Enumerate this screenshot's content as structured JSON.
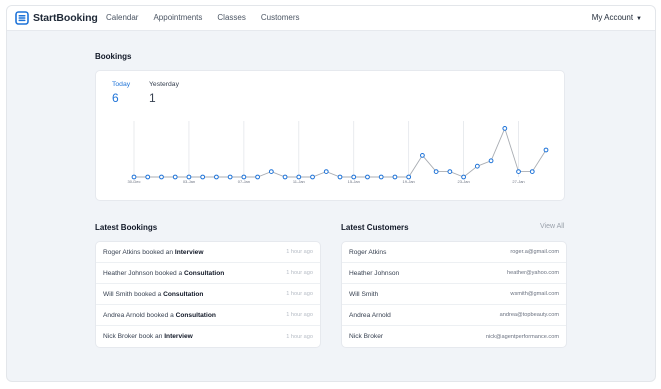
{
  "app": {
    "logo_text": "StartBooking",
    "nav": [
      "Calendar",
      "Appointments",
      "Classes",
      "Customers"
    ],
    "account_label": "My Account"
  },
  "bookings": {
    "title": "Bookings",
    "today_label": "Today",
    "today_value": "6",
    "yesterday_label": "Yesterday",
    "yesterday_value": "1"
  },
  "chart_data": {
    "type": "line",
    "title": "",
    "xlabel": "",
    "ylabel": "",
    "x_tick_labels": [
      "30-Dec",
      "03-Jan",
      "07-Jan",
      "11-Jan",
      "15-Jan",
      "19-Jan",
      "23-Jan",
      "27-Jan"
    ],
    "x": [
      "30-Dec",
      "31-Dec",
      "01-Jan",
      "02-Jan",
      "03-Jan",
      "04-Jan",
      "05-Jan",
      "06-Jan",
      "07-Jan",
      "08-Jan",
      "09-Jan",
      "10-Jan",
      "11-Jan",
      "12-Jan",
      "13-Jan",
      "14-Jan",
      "15-Jan",
      "16-Jan",
      "17-Jan",
      "18-Jan",
      "19-Jan",
      "20-Jan",
      "21-Jan",
      "22-Jan",
      "23-Jan",
      "24-Jan",
      "25-Jan",
      "26-Jan",
      "27-Jan",
      "28-Jan",
      "29-Jan"
    ],
    "series": [
      {
        "values": [
          0,
          0,
          0,
          0,
          0,
          0,
          0,
          0,
          0,
          0,
          1,
          0,
          0,
          0,
          1,
          0,
          0,
          0,
          0,
          0,
          0,
          4,
          1,
          1,
          0,
          2,
          3,
          9,
          1,
          1,
          5
        ]
      }
    ],
    "ylim": [
      0,
      10
    ],
    "grid": "vertical",
    "colors": {
      "line": "#a9adb3",
      "point": "#1e73d8",
      "grid": "#e3e6ea"
    }
  },
  "latest_bookings": {
    "title": "Latest Bookings",
    "items": [
      {
        "pre": "Roger Atkins booked an ",
        "bold": "Interview",
        "time": "1 hour ago"
      },
      {
        "pre": "Heather Johnson booked a ",
        "bold": "Consultation",
        "time": "1 hour ago"
      },
      {
        "pre": "Will Smith booked a ",
        "bold": "Consultation",
        "time": "1 hour ago"
      },
      {
        "pre": "Andrea Arnold booked a ",
        "bold": "Consultation",
        "time": "1 hour ago"
      },
      {
        "pre": "Nick Broker book an ",
        "bold": "Interview",
        "time": "1 hour ago"
      }
    ]
  },
  "latest_customers": {
    "title": "Latest Customers",
    "view_all": "View All",
    "items": [
      {
        "name": "Roger Atkins",
        "email": "roger.a@gmail.com"
      },
      {
        "name": "Heather Johnson",
        "email": "heather@yahoo.com"
      },
      {
        "name": "Will Smith",
        "email": "wsmith@gmail.com"
      },
      {
        "name": "Andrea Arnold",
        "email": "andrea@topbeauty.com"
      },
      {
        "name": "Nick Broker",
        "email": "nick@agentperformance.com"
      }
    ]
  }
}
